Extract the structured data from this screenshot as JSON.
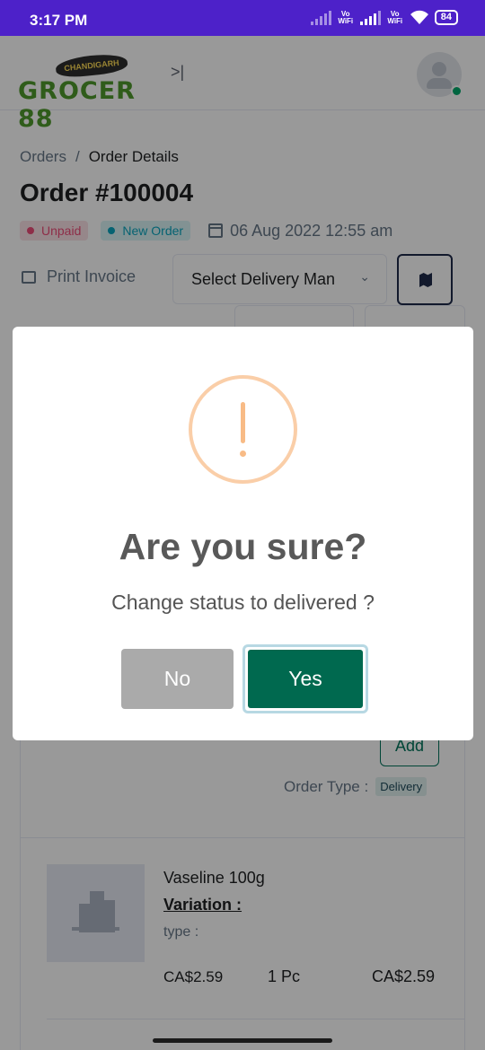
{
  "status_bar": {
    "time": "3:17 PM",
    "vowifi_1": "Vo WiFi",
    "vowifi_2": "Vo WiFi",
    "battery": "84"
  },
  "header": {
    "logo_banner": "CHANDIGARH",
    "logo_text": "GROCER 88",
    "toggle_icon": "sidebar-expand-icon"
  },
  "breadcrumb": {
    "parent": "Orders",
    "separator": "/",
    "current": "Order Details"
  },
  "order": {
    "title": "Order #100004",
    "payment_badge": "Unpaid",
    "status_badge": "New Order",
    "date": "06 Aug 2022 12:55 am",
    "print_label": "Print Invoice",
    "delivery_man_select": "Select Delivery Man"
  },
  "order_type": {
    "label": "Order Type :",
    "value": "Delivery"
  },
  "add_button": "Add",
  "product": {
    "name": "Vaseline 100g",
    "variation_label": "Variation :",
    "type_label": "type :",
    "price": "CA$2.59",
    "quantity": "1 Pc",
    "total": "CA$2.59"
  },
  "modal": {
    "title": "Are you sure?",
    "text": "Change status to delivered ?",
    "no_label": "No",
    "yes_label": "Yes"
  },
  "colors": {
    "status_bar": "#4d21c9",
    "brand_green": "#00694f",
    "warning": "#f8bb86",
    "unpaid": "#ed4c78",
    "new_order": "#09a5be"
  }
}
